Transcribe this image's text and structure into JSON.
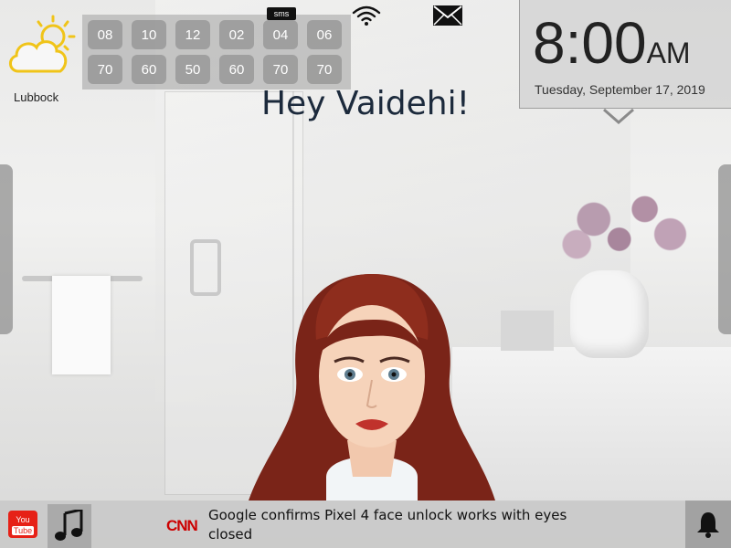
{
  "weather": {
    "city": "Lubbock",
    "icon": "partly-cloudy-icon",
    "accent": "#f0c419"
  },
  "forecast": {
    "hours": [
      "08",
      "10",
      "12",
      "02",
      "04",
      "06"
    ],
    "temps": [
      "70",
      "60",
      "50",
      "60",
      "70",
      "70"
    ]
  },
  "status": {
    "sms_label": "sms",
    "wifi_icon": "wifi-icon",
    "mail_icon": "mail-icon"
  },
  "clock": {
    "time": "8:00",
    "ampm": "AM",
    "date": "Tuesday, September 17, 2019"
  },
  "greeting": "Hey Vaidehi!",
  "bottom": {
    "youtube": {
      "top": "You",
      "bottom": "Tube"
    },
    "music_icon": "music-note-icon",
    "news_source": "CNN",
    "headline": "Google confirms Pixel 4 face unlock works with eyes closed",
    "bell_icon": "bell-icon"
  }
}
